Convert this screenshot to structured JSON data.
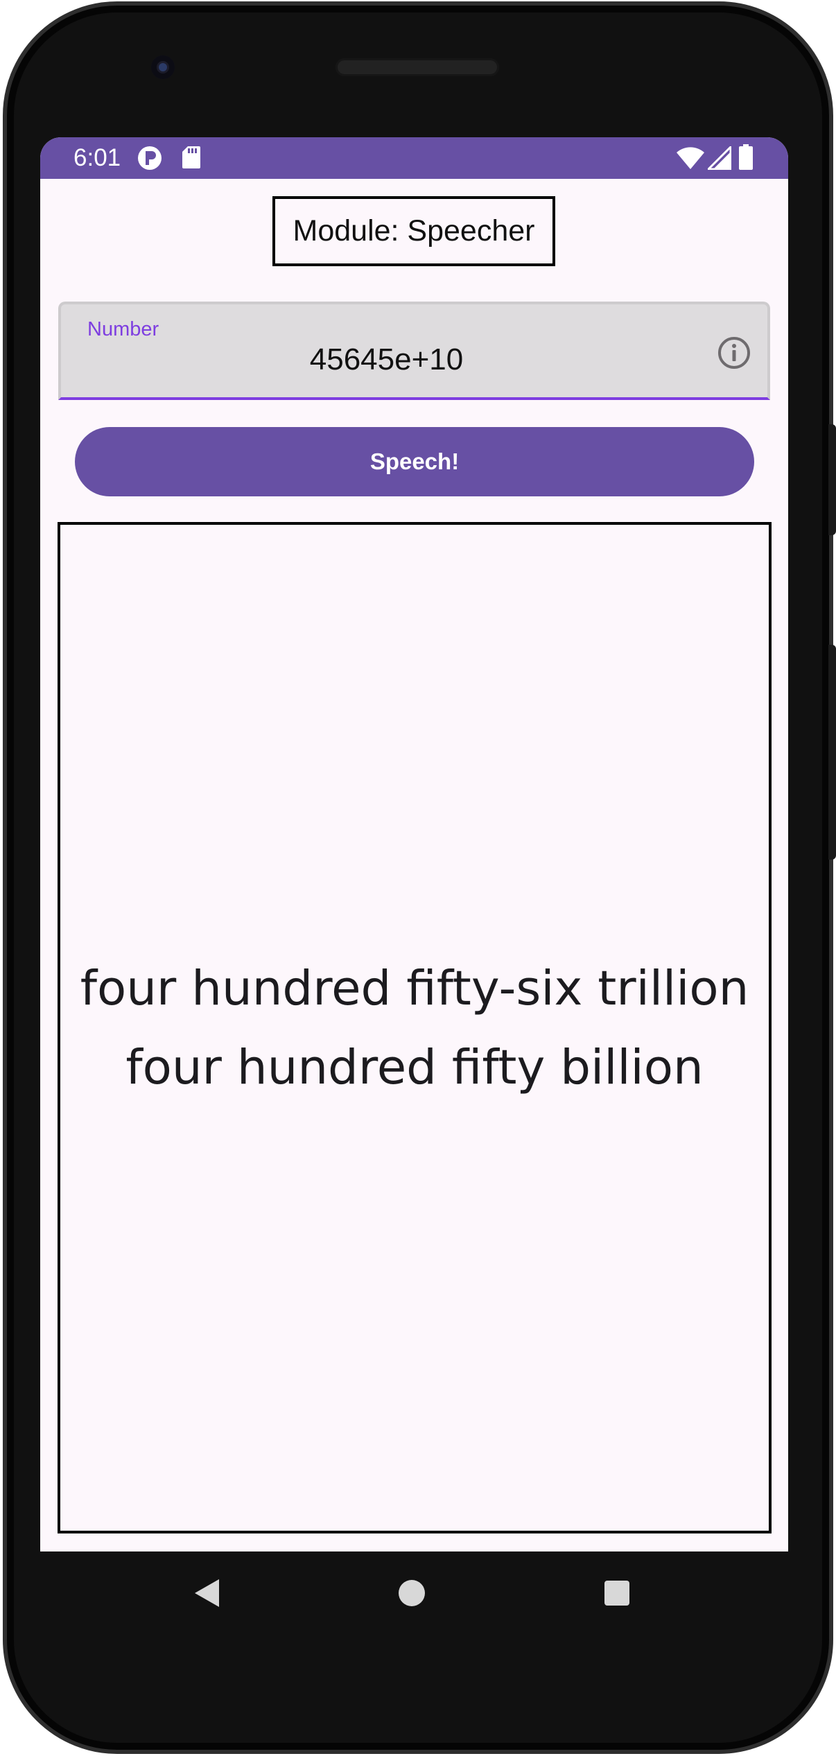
{
  "status_bar": {
    "time": "6:01",
    "left_icons": [
      "profile-badge-icon",
      "sd-card-icon"
    ],
    "right_icons": [
      "wifi-icon",
      "cell-signal-icon",
      "battery-icon"
    ]
  },
  "app": {
    "title": "Module: Speecher"
  },
  "number_field": {
    "label": "Number",
    "value": "45645e+10",
    "trailing_icon": "info-icon"
  },
  "speech_button": {
    "label": "Speech!"
  },
  "output": {
    "text": "four hundred fifty-six trillion four hundred fifty billion"
  },
  "nav_bar": {
    "buttons": [
      "back-icon",
      "home-icon",
      "recents-icon"
    ]
  },
  "colors": {
    "primary": "#6750a4",
    "focus": "#7e3ee0",
    "background": "#fdf7fc",
    "field_background": "#dedcde"
  }
}
